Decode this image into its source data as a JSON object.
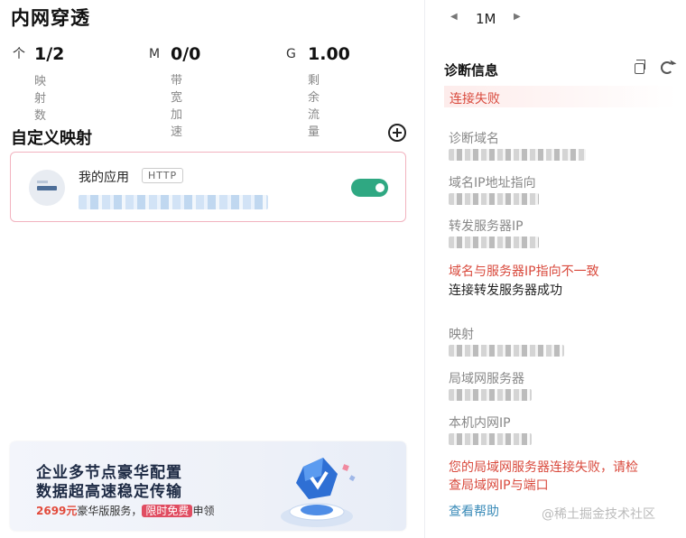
{
  "page": {
    "title": "内网穿透"
  },
  "stats": [
    {
      "value": "1/2",
      "unit": "个",
      "label": "映射数"
    },
    {
      "value": "0/0",
      "unit": "M",
      "label": "带宽加速"
    },
    {
      "value": "1.00",
      "unit": "G",
      "label": "剩余流量"
    }
  ],
  "mapping": {
    "section_title": "自定义映射",
    "app_name": "我的应用",
    "protocol": "HTTP",
    "toggle_on": true
  },
  "banner": {
    "line1": "企业多节点豪华配置",
    "line2": "数据超高速稳定传输",
    "price": "2699元",
    "service": "豪华版服务，",
    "free_badge": "限时免费",
    "apply": "申领"
  },
  "nav": {
    "current": "1M"
  },
  "diagnosis": {
    "title": "诊断信息",
    "status": "连接失败",
    "labels": {
      "domain": "诊断域名",
      "domain_ip": "域名IP地址指向",
      "forward_server_ip": "转发服务器IP",
      "mapping": "映射",
      "lan_server": "局域网服务器",
      "local_ip": "本机内网IP"
    },
    "error_ip_mismatch": "域名与服务器IP指向不一致",
    "forward_ok": "连接转发服务器成功",
    "error_lan_line1": "您的局域网服务器连接失败，请检",
    "error_lan_line2": "查局域网IP与端口",
    "help_link": "查看帮助"
  },
  "watermark": "@稀土掘金技术社区",
  "colors": {
    "accent_green": "#2fa882",
    "error_red": "#d94a3d",
    "card_border": "#f2b3bf",
    "link_blue": "#3a8bb8"
  }
}
